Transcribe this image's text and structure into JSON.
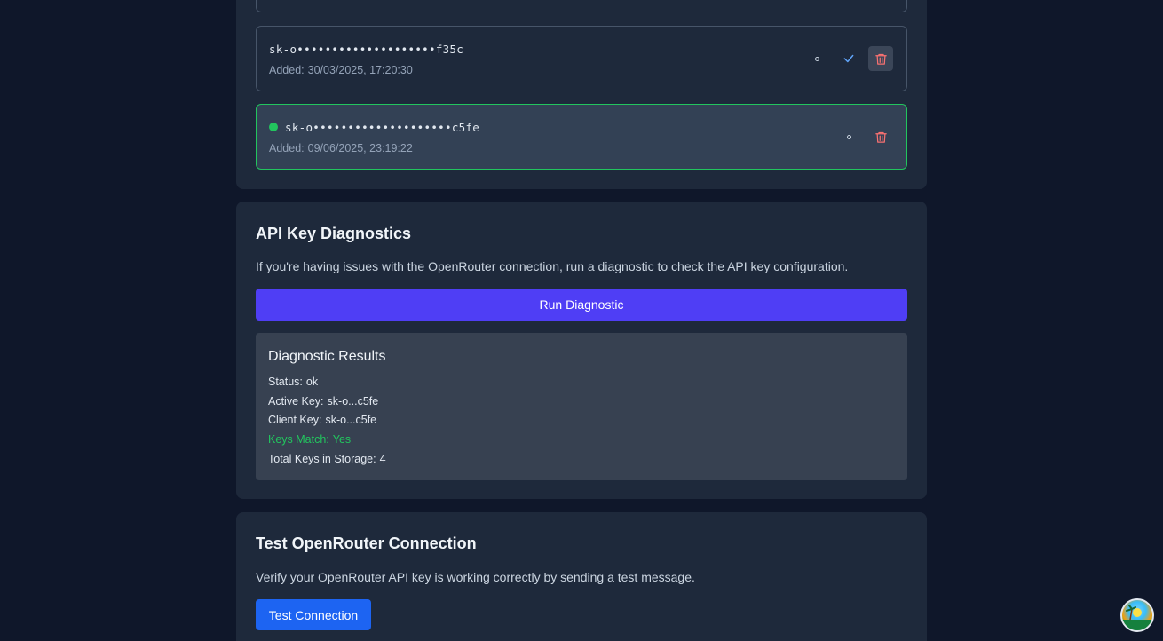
{
  "keys": [
    {
      "value": "sk-o••••••••••••••••••••f35c",
      "added_label": "Added:",
      "added_value": "30/03/2025, 17:20:30",
      "active": false
    },
    {
      "value": "sk-o••••••••••••••••••••c5fe",
      "added_label": "Added:",
      "added_value": "09/06/2025, 23:19:22",
      "active": true
    }
  ],
  "diagnostics": {
    "title": "API Key Diagnostics",
    "description": "If you're having issues with the OpenRouter connection, run a diagnostic to check the API key configuration.",
    "button_label": "Run Diagnostic",
    "results": {
      "title": "Diagnostic Results",
      "lines": [
        {
          "label": "Status:",
          "value": "ok"
        },
        {
          "label": "Active Key:",
          "value": "sk-o...c5fe"
        },
        {
          "label": "Client Key:",
          "value": "sk-o...c5fe"
        },
        {
          "label": "Keys Match:",
          "value": "Yes"
        },
        {
          "label": "Total Keys in Storage:",
          "value": "4"
        }
      ]
    }
  },
  "test": {
    "title": "Test OpenRouter Connection",
    "description": "Verify your OpenRouter API key is working correctly by sending a test message.",
    "button_label": "Test Connection"
  },
  "colors": {
    "active_accent": "#22c55e",
    "run_button": "#4f3ef5",
    "test_button": "#1d64f2",
    "delete_icon": "#f87171",
    "check_icon": "#60a5fa"
  },
  "icons": {
    "options": "ring-dot-icon",
    "set_active": "check-icon",
    "delete": "trash-icon"
  }
}
